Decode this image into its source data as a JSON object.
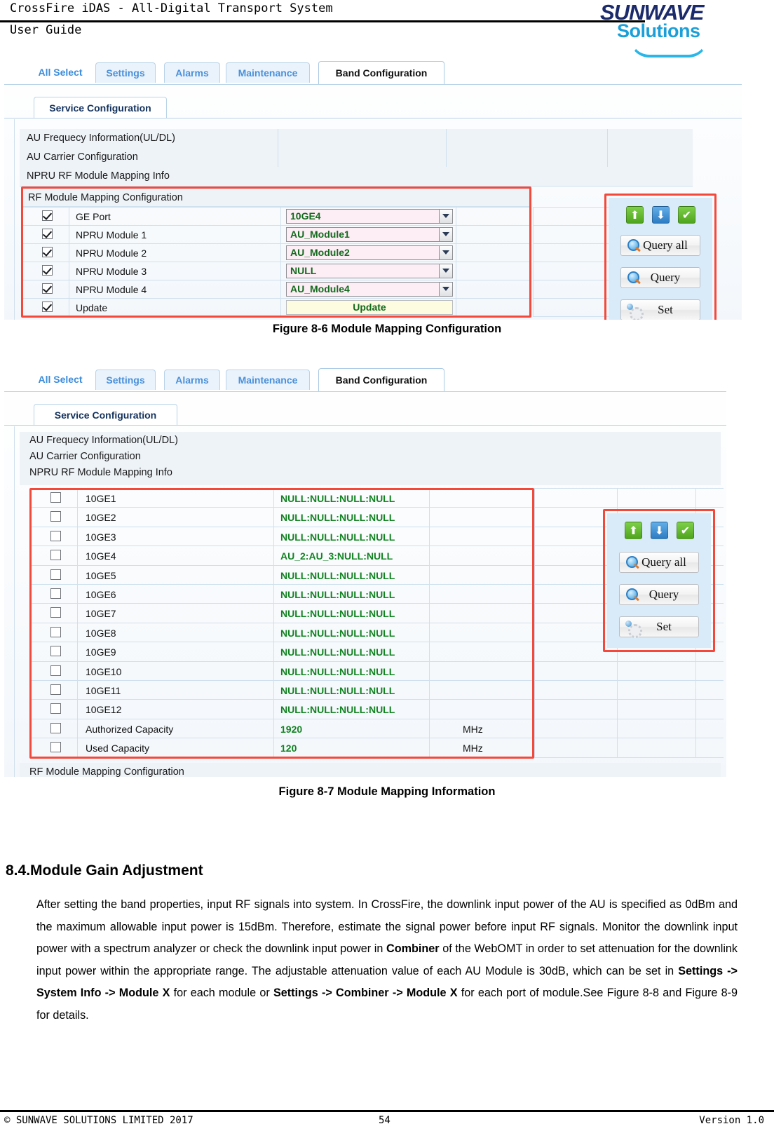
{
  "header": {
    "title": "CrossFire iDAS - All-Digital Transport System",
    "subtitle": "User Guide",
    "logo_primary": "SUNWAVE",
    "logo_secondary": "Solutions"
  },
  "figure86": {
    "tabs": [
      {
        "label": "All Select",
        "state": "plain"
      },
      {
        "label": "Settings",
        "state": "inactive"
      },
      {
        "label": "Alarms",
        "state": "inactive"
      },
      {
        "label": "Maintenance",
        "state": "inactive"
      },
      {
        "label": "Band Configuration",
        "state": "active"
      }
    ],
    "subtab": "Service Configuration",
    "sections": [
      "AU Frequecy Information(UL/DL)",
      "AU Carrier Configuration",
      "NPRU RF Module Mapping Info"
    ],
    "panel_title": "RF Module Mapping Configuration",
    "rows": [
      {
        "checked": true,
        "label": "GE Port",
        "value": "10GE4",
        "type": "select"
      },
      {
        "checked": true,
        "label": "NPRU Module 1",
        "value": "AU_Module1",
        "type": "select"
      },
      {
        "checked": true,
        "label": "NPRU Module 2",
        "value": "AU_Module2",
        "type": "select"
      },
      {
        "checked": true,
        "label": "NPRU Module 3",
        "value": "NULL",
        "type": "select"
      },
      {
        "checked": true,
        "label": "NPRU Module 4",
        "value": "AU_Module4",
        "type": "select"
      },
      {
        "checked": true,
        "label": "Update",
        "value": "Update",
        "type": "button"
      }
    ],
    "actions": {
      "icons": [
        "upload-icon",
        "download-icon",
        "check-icon"
      ],
      "icon_glyphs": [
        "⬆",
        "⬇",
        "✔"
      ],
      "buttons": [
        "Query all",
        "Query",
        "Set"
      ]
    },
    "caption": "Figure 8-6 Module Mapping Configuration"
  },
  "figure87": {
    "tabs": [
      {
        "label": "All Select",
        "state": "plain"
      },
      {
        "label": "Settings",
        "state": "inactive"
      },
      {
        "label": "Alarms",
        "state": "inactive"
      },
      {
        "label": "Maintenance",
        "state": "inactive"
      },
      {
        "label": "Band Configuration",
        "state": "active"
      }
    ],
    "subtab": "Service Configuration",
    "sections": [
      "AU Frequecy Information(UL/DL)",
      "AU Carrier Configuration",
      "NPRU RF Module Mapping Info"
    ],
    "rows": [
      {
        "checked": false,
        "label": "10GE1",
        "value": "NULL:NULL:NULL:NULL",
        "unit": ""
      },
      {
        "checked": false,
        "label": "10GE2",
        "value": "NULL:NULL:NULL:NULL",
        "unit": ""
      },
      {
        "checked": false,
        "label": "10GE3",
        "value": "NULL:NULL:NULL:NULL",
        "unit": ""
      },
      {
        "checked": false,
        "label": "10GE4",
        "value": "AU_2:AU_3:NULL:NULL",
        "unit": ""
      },
      {
        "checked": false,
        "label": "10GE5",
        "value": "NULL:NULL:NULL:NULL",
        "unit": ""
      },
      {
        "checked": false,
        "label": "10GE6",
        "value": "NULL:NULL:NULL:NULL",
        "unit": ""
      },
      {
        "checked": false,
        "label": "10GE7",
        "value": "NULL:NULL:NULL:NULL",
        "unit": ""
      },
      {
        "checked": false,
        "label": "10GE8",
        "value": "NULL:NULL:NULL:NULL",
        "unit": ""
      },
      {
        "checked": false,
        "label": "10GE9",
        "value": "NULL:NULL:NULL:NULL",
        "unit": ""
      },
      {
        "checked": false,
        "label": "10GE10",
        "value": "NULL:NULL:NULL:NULL",
        "unit": ""
      },
      {
        "checked": false,
        "label": "10GE11",
        "value": "NULL:NULL:NULL:NULL",
        "unit": ""
      },
      {
        "checked": false,
        "label": "10GE12",
        "value": "NULL:NULL:NULL:NULL",
        "unit": ""
      },
      {
        "checked": false,
        "label": "Authorized Capacity",
        "value": "1920",
        "unit": "MHz"
      },
      {
        "checked": false,
        "label": "Used Capacity",
        "value": "120",
        "unit": "MHz"
      }
    ],
    "footer_section": "RF Module Mapping Configuration",
    "actions": {
      "icons": [
        "upload-icon",
        "download-icon",
        "check-icon"
      ],
      "icon_glyphs": [
        "⬆",
        "⬇",
        "✔"
      ],
      "buttons": [
        "Query all",
        "Query",
        "Set"
      ]
    },
    "caption": "Figure 8-7 Module Mapping Information"
  },
  "section": {
    "number": "8.4.",
    "heading": "Module Gain Adjustment",
    "paragraph_html": "After setting the band properties, input RF signals into system. In CrossFire, the downlink input power of the AU is specified as 0dBm and the maximum allowable input power is 15dBm. Therefore, estimate the signal power before input RF signals. Monitor the downlink input power with a spectrum analyzer or check the downlink input power in <b>Combiner</b> of the WebOMT in order to set attenuation for the downlink input power within the appropriate range. The adjustable attenuation value of each AU Module is 30dB, which can be set in <b>Settings -&gt; System Info -&gt; Module X</b> for each module or <b>Settings -&gt; Combiner -&gt; Module X</b> for each port of module.See Figure 8-8 and Figure 8-9 for details."
  },
  "footer": {
    "copyright": "© SUNWAVE SOLUTIONS LIMITED 2017",
    "page": "54",
    "version": "Version 1.0"
  }
}
